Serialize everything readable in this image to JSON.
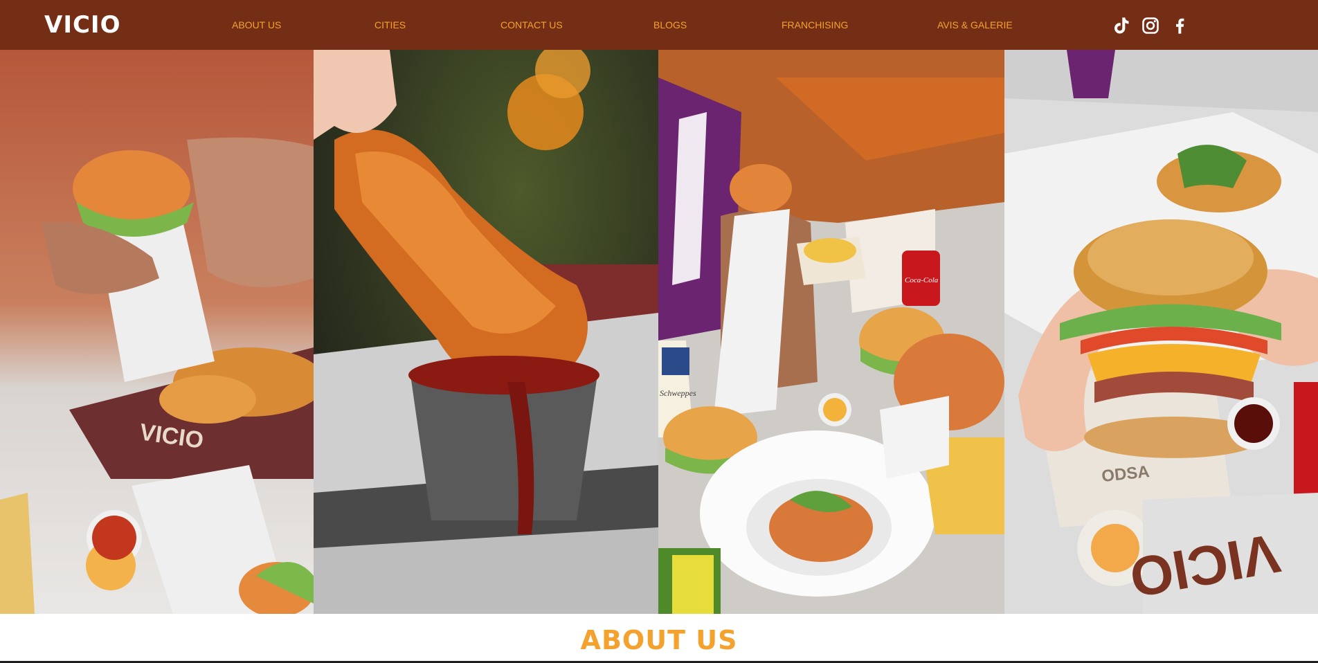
{
  "header": {
    "logo": "VICIO",
    "nav": [
      {
        "label": "ABOUT US"
      },
      {
        "label": "CITIES"
      },
      {
        "label": "CONTACT US"
      },
      {
        "label": "BLOGS"
      },
      {
        "label": "FRANCHISING"
      },
      {
        "label": "AVIS & GALERIE"
      }
    ],
    "social": [
      {
        "icon": "tiktok-icon"
      },
      {
        "icon": "instagram-icon"
      },
      {
        "icon": "facebook-icon"
      }
    ]
  },
  "hero": {
    "panels": [
      {
        "subject": "chicken-wrap-photo"
      },
      {
        "subject": "chicken-tender-dip-photo"
      },
      {
        "subject": "meal-spread-photo"
      },
      {
        "subject": "burger-photo"
      }
    ],
    "print": {
      "box_brand": "VICIO",
      "soda_brand": "Coca-Cola",
      "tonic_brand": "Schweppes"
    }
  },
  "about": {
    "title": "ABOUT US"
  },
  "colors": {
    "header_bg": "#742e16",
    "accent": "#f4a22d",
    "logo": "#ffffff",
    "page_bg": "#ffffff"
  }
}
